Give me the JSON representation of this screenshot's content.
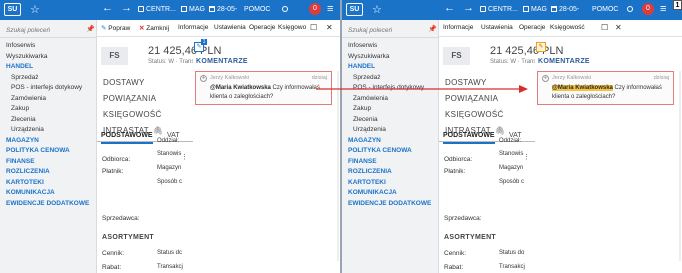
{
  "app": {
    "logo": "SU",
    "badge_number": "1"
  },
  "topbar": {
    "company": "CENTR...",
    "warehouse": "MAG",
    "date": "28-05-",
    "help": "POMOC",
    "notifications": "0"
  },
  "nav": {
    "search_placeholder": "Szukaj poleceń",
    "items": [
      {
        "label": "Infoserwis",
        "type": "item"
      },
      {
        "label": "Wyszukiwarka",
        "type": "item"
      },
      {
        "label": "HANDEL",
        "type": "head"
      },
      {
        "label": "Sprzedaż",
        "type": "sub"
      },
      {
        "label": "POS - interfejs dotykowy",
        "type": "sub"
      },
      {
        "label": "Zamówienia",
        "type": "sub"
      },
      {
        "label": "Zakup",
        "type": "sub"
      },
      {
        "label": "Zlecenia",
        "type": "sub"
      },
      {
        "label": "Urządzenia",
        "type": "sub"
      },
      {
        "label": "MAGAZYN",
        "type": "head"
      },
      {
        "label": "POLITYKA CENOWA",
        "type": "head"
      },
      {
        "label": "FINANSE",
        "type": "head"
      },
      {
        "label": "ROZLICZENIA",
        "type": "head"
      },
      {
        "label": "KARTOTEKI",
        "type": "head"
      },
      {
        "label": "KOMUNIKACJA",
        "type": "head"
      },
      {
        "label": "EWIDENCJE DODATKOWE",
        "type": "head"
      }
    ]
  },
  "panel1": {
    "toolbar": {
      "fix": "Popraw",
      "close": "Zamknij",
      "info": "Informacje",
      "settings": "Ustawienia",
      "ops": "Operacje",
      "books": "Księgowo"
    },
    "comment_count": "1"
  },
  "panel2": {
    "toolbar": {
      "info": "Informacje",
      "settings": "Ustawienia",
      "ops": "Operacje",
      "books": "Księgowość"
    }
  },
  "document": {
    "type_code": "FS",
    "amount": "21 425,46 PLN",
    "status": "Status: W",
    "status2": "Transakcja:",
    "sections": [
      "DOSTAWY",
      "POWIĄZANIA",
      "KSIĘGOWOŚĆ",
      "INTRASTAT"
    ],
    "tabs": [
      "PODSTAWOWE",
      "VAT"
    ],
    "fields": {
      "recipient": "Odbiorca:",
      "payer": "Płatnik:",
      "seller": "Sprzedawca:",
      "assortment": "ASORTYMENT",
      "pricelist": "Cennik:",
      "discount": "Rabat:",
      "p1_col": [
        "Stanowis",
        "Magazyn",
        "Sposób c",
        "Status dc",
        "Transakcj"
      ],
      "p2_col": [
        "Stanowis",
        "Magazyn",
        "Sposób c",
        "Status do",
        "Transakcj"
      ],
      "p1_top": "Oddział:",
      "p2_top": "Oddział:"
    }
  },
  "comments": {
    "title": "KOMENTARZE",
    "author": "Jerzy Kalkowski",
    "date": "dzisiaj",
    "mention": "@Maria Kwiatkowska",
    "text": "Czy informowałaś klienta o zaległościach?"
  },
  "colors": {
    "topbar": "#1b73c8",
    "highlight": "#f5c242",
    "arrow": "#d62d2d",
    "card_border": "#e47a7a"
  }
}
